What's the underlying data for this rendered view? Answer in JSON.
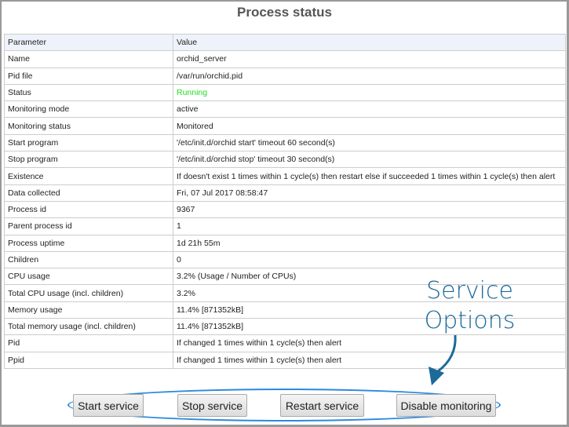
{
  "title": "Process status",
  "table": {
    "headers": [
      "Parameter",
      "Value"
    ],
    "rows": [
      [
        "Name",
        "orchid_server"
      ],
      [
        "Pid file",
        "/var/run/orchid.pid"
      ],
      [
        "Status",
        "Running"
      ],
      [
        "Monitoring mode",
        "active"
      ],
      [
        "Monitoring status",
        "Monitored"
      ],
      [
        "Start program",
        "'/etc/init.d/orchid start' timeout 60 second(s)"
      ],
      [
        "Stop program",
        "'/etc/init.d/orchid stop' timeout 30 second(s)"
      ],
      [
        "Existence",
        "If doesn't exist 1 times within 1 cycle(s) then restart else if succeeded 1 times within 1 cycle(s) then alert"
      ],
      [
        "Data collected",
        "Fri, 07 Jul 2017 08:58:47"
      ],
      [
        "Process id",
        "9367"
      ],
      [
        "Parent process id",
        "1"
      ],
      [
        "Process uptime",
        "1d 21h 55m"
      ],
      [
        "Children",
        "0"
      ],
      [
        "CPU usage",
        "3.2%   (Usage / Number of CPUs)"
      ],
      [
        "Total CPU usage (incl. children)",
        "3.2%"
      ],
      [
        "Memory usage",
        "11.4% [871352kB]"
      ],
      [
        "Total memory usage (incl. children)",
        "11.4% [871352kB]"
      ],
      [
        "Pid",
        "If changed 1 times within 1 cycle(s) then alert"
      ],
      [
        "Ppid",
        "If changed 1 times within 1 cycle(s) then alert"
      ]
    ]
  },
  "buttons": {
    "start": "Start service",
    "stop": "Stop service",
    "restart": "Restart service",
    "disable": "Disable monitoring"
  },
  "annotation": {
    "line1": "Service",
    "line2": "Options",
    "color": "#1c6a99"
  },
  "status_color": "#22dd22"
}
